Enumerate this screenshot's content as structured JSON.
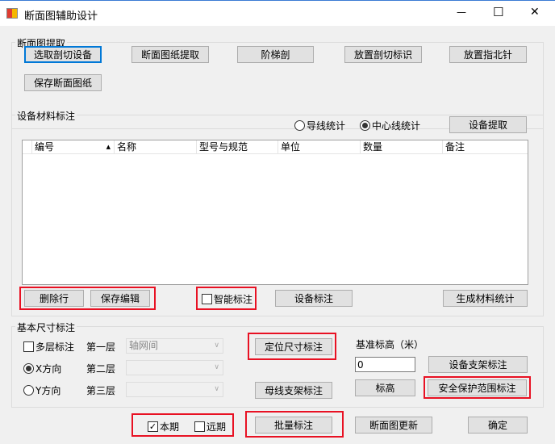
{
  "window": {
    "title": "断面图辅助设计",
    "minimize": "—",
    "maximize": "☐",
    "close": "✕"
  },
  "group1": {
    "label": "断面图提取",
    "buttons": [
      "选取剖切设备",
      "断面图纸提取",
      "阶梯剖",
      "放置剖切标识",
      "放置指北针",
      "保存断面图纸"
    ]
  },
  "group2": {
    "label": "设备材料标注",
    "radio_wire": "导线统计",
    "radio_center": "中心线统计",
    "extract": "设备提取",
    "columns": [
      "编号",
      "名称",
      "型号与规范",
      "单位",
      "数量",
      "备注"
    ],
    "delete_row": "删除行",
    "save_edit": "保存编辑",
    "smart_label": "智能标注",
    "device_label": "设备标注",
    "gen_stats": "生成材料统计"
  },
  "group3": {
    "label": "基本尺寸标注",
    "multi": "多层标注",
    "x_dir": "X方向",
    "y_dir": "Y方向",
    "layer1": "第一层",
    "layer2": "第二层",
    "layer3": "第三层",
    "layer1_value": "轴网间",
    "locate": "定位尺寸标注",
    "busbar": "母线支架标注",
    "base_elev_label": "基准标高（米）",
    "base_elev_value": "0",
    "device_support": "设备支架标注",
    "elev": "标高",
    "safety": "安全保护范围标注"
  },
  "bottom": {
    "current": "本期",
    "future": "远期",
    "batch": "批量标注",
    "update": "断面图更新",
    "ok": "确定"
  }
}
